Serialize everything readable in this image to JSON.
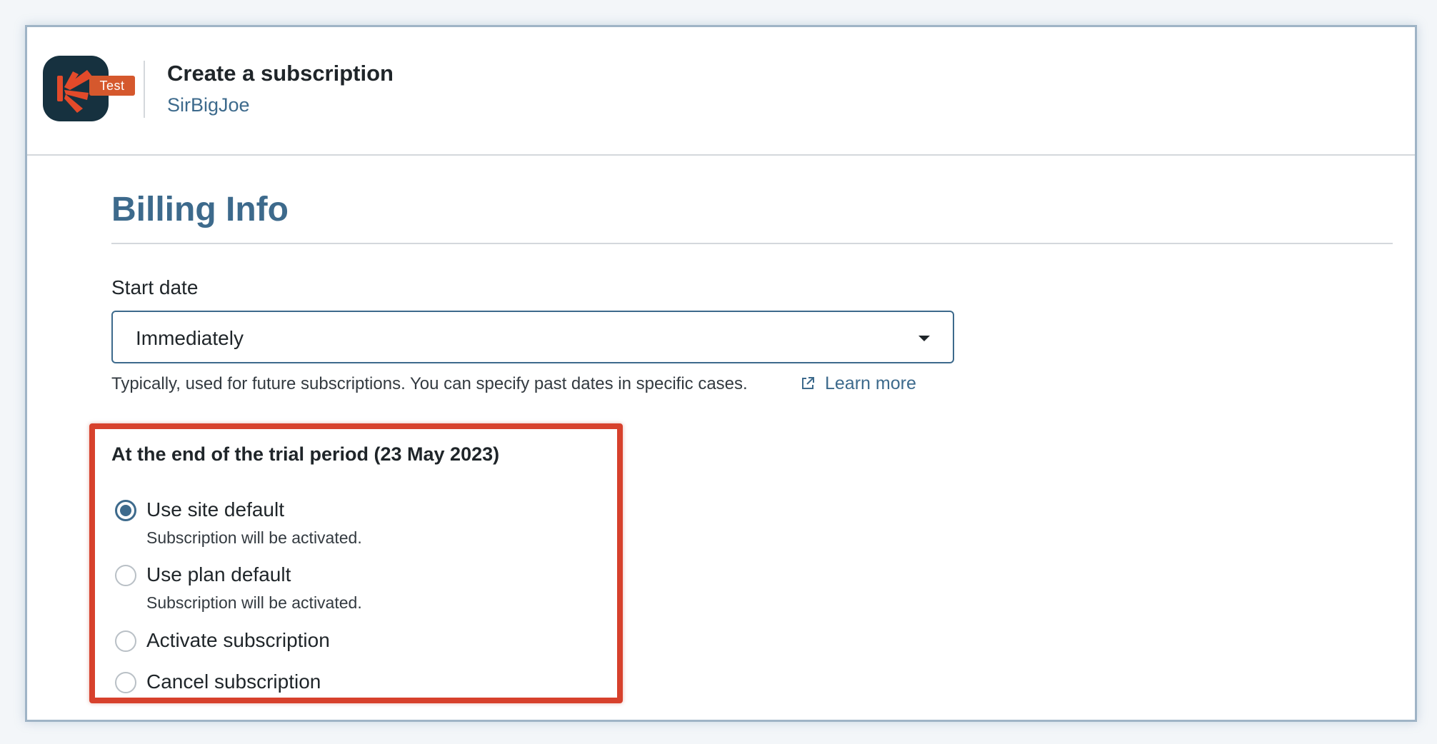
{
  "header": {
    "badge": "Test",
    "title": "Create a subscription",
    "subtitle": "SirBigJoe",
    "logo_color": "#16313f",
    "badge_color": "#d5582d"
  },
  "billing": {
    "section_title": "Billing Info",
    "start_date": {
      "label": "Start date",
      "selected": "Immediately",
      "help_text": "Typically, used for future subscriptions. You can specify past dates in specific cases.",
      "learn_more": "Learn more"
    },
    "trial_end": {
      "title": "At the end of the trial period (23 May 2023)",
      "options": [
        {
          "label": "Use site default",
          "description": "Subscription will be activated.",
          "checked": true
        },
        {
          "label": "Use plan default",
          "description": "Subscription will be activated.",
          "checked": false
        },
        {
          "label": "Activate subscription",
          "description": "",
          "checked": false
        },
        {
          "label": "Cancel subscription",
          "description": "",
          "checked": false
        }
      ]
    }
  },
  "colors": {
    "accent": "#3d6a8c",
    "highlight": "#d7412c",
    "text": "#1f2529"
  }
}
